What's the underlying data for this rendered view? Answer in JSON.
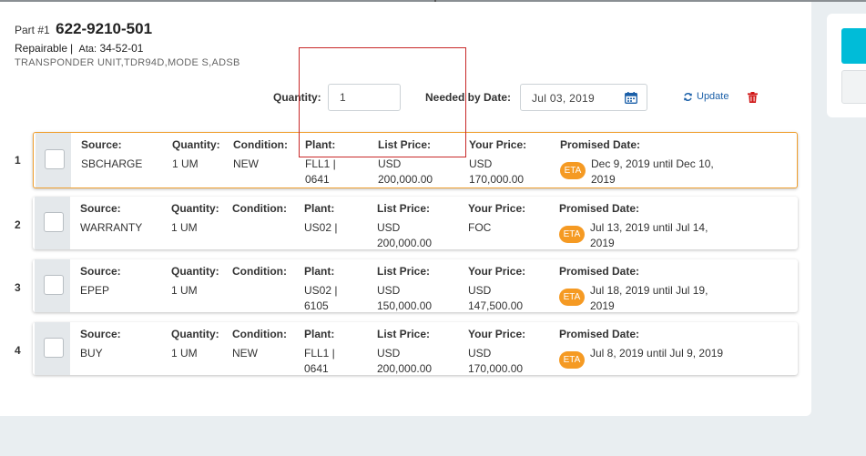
{
  "header": {
    "part_prefix": "Part #1",
    "part_number": "622-9210-501",
    "repairable": "Repairable",
    "ata_label": "Ata:",
    "ata_value": "34-52-01",
    "description": "TRANSPONDER UNIT,TDR94D,MODE S,ADSB"
  },
  "controls": {
    "quantity_label": "Quantity:",
    "quantity_value": "1",
    "needed_label": "Needed by Date:",
    "needed_date": "Jul 03, 2019",
    "update_label": "Update"
  },
  "columns": {
    "source": "Source:",
    "quantity": "Quantity:",
    "condition": "Condition:",
    "plant": "Plant:",
    "list_price": "List Price:",
    "your_price": "Your Price:",
    "promised": "Promised Date:"
  },
  "eta_label": "ETA",
  "rows": [
    {
      "num": "1",
      "source": "SBCHARGE",
      "quantity": "1 UM",
      "condition": "NEW",
      "plant": "FLL1 |\n0641",
      "list_price": "USD\n200,000.00",
      "your_price": "USD\n170,000.00",
      "promised": "Dec 9, 2019 until Dec 10,\n2019"
    },
    {
      "num": "2",
      "source": "WARRANTY",
      "quantity": "1 UM",
      "condition": "",
      "plant": "US02 |",
      "list_price": "USD\n200,000.00",
      "your_price": "FOC",
      "promised": "Jul 13, 2019 until Jul 14,\n2019"
    },
    {
      "num": "3",
      "source": "EPEP",
      "quantity": "1 UM",
      "condition": "",
      "plant": "US02 |\n6105",
      "list_price": "USD\n150,000.00",
      "your_price": "USD\n147,500.00",
      "promised": "Jul 18, 2019 until Jul 19,\n2019"
    },
    {
      "num": "4",
      "source": "BUY",
      "quantity": "1 UM",
      "condition": "NEW",
      "plant": "FLL1 |\n0641",
      "list_price": "USD\n200,000.00",
      "your_price": "USD\n170,000.00",
      "promised": "Jul 8, 2019 until Jul 9, 2019"
    }
  ],
  "selected_row": "1",
  "colors": {
    "accent": "#00bcd8",
    "eta": "#f59a23",
    "selected_border": "#f0a030",
    "link": "#1a5fa8",
    "delete": "#d01818"
  }
}
